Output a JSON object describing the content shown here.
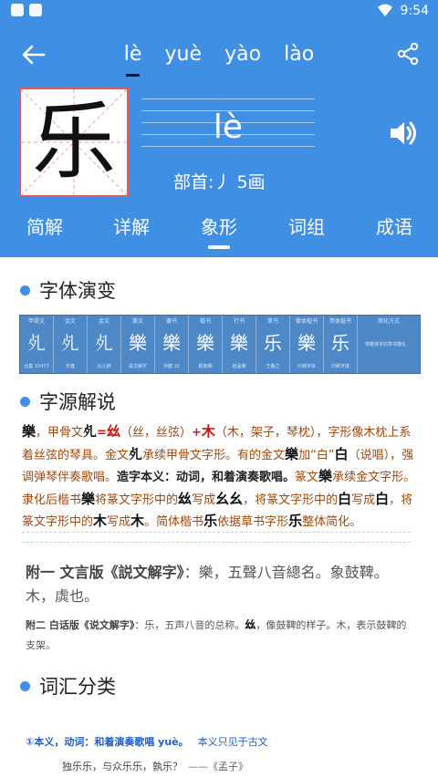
{
  "status_bar": {
    "time": "9:54"
  },
  "pinyin_tabs": [
    "lè",
    "yuè",
    "yào",
    "lào"
  ],
  "character": "乐",
  "reading": "lè",
  "radical_line": "部首:丿  5画",
  "section_tabs": [
    "简解",
    "详解",
    "象形",
    "词组",
    "成语"
  ],
  "sections": {
    "evolution": "字体演变",
    "etymology": "字源解说",
    "vocab": "词汇分类"
  },
  "evolution_table": {
    "columns": [
      {
        "label": "甲骨文",
        "glyph": "𣦷",
        "source": "合集 10477"
      },
      {
        "label": "金文",
        "glyph": "𣦷",
        "source": "乐簋"
      },
      {
        "label": "金文",
        "glyph": "𣦷",
        "source": "沇儿钟"
      },
      {
        "label": "篆文",
        "glyph": "樂",
        "source": "说文解字"
      },
      {
        "label": "隶书",
        "glyph": "樂",
        "source": "孙膑 15"
      },
      {
        "label": "楷书",
        "glyph": "樂",
        "source": "颜真卿"
      },
      {
        "label": "行书",
        "glyph": "樂",
        "source": "赵孟頫"
      },
      {
        "label": "草书",
        "glyph": "乐",
        "source": "王羲之"
      },
      {
        "label": "繁体楷书",
        "glyph": "樂",
        "source": "印刷字体"
      },
      {
        "label": "简体楷书",
        "glyph": "乐",
        "source": "印刷字体"
      }
    ],
    "last_header": "简化方式",
    "note": "将繁体字的草书楷化"
  },
  "etymology": {
    "t1": "樂",
    "t2": "，甲骨文",
    "t3": "（丝，丝弦）",
    "t4": "+",
    "t5": "（木，架子，琴枕）",
    "t6": "，字形像木枕上系着丝弦的琴具。金文",
    "t7": "承续甲骨文字形。有的金文",
    "t8": "加“白”",
    "t9": "（说唱），强调弹琴伴奏歌唱。",
    "t10": "造字本义：动词，和着演奏歌唱。",
    "t11": "篆文",
    "t12": "承续金文字形。隶化后楷书",
    "t13": "将篆文字形中的",
    "t14": "写成",
    "t15": "，将篆文字形中的",
    "t16": "写成",
    "t17": "，将篆文字形中的",
    "t18": "写成",
    "t19": "。简体楷书",
    "t20": "依据草书字形",
    "t21": "整体简化。",
    "g_jia": "𣦷",
    "g_si": "𢆶",
    "g_mu": "木",
    "g_jin": "𣦷",
    "g_jin2": "樂",
    "g_bai": "白",
    "g_zhuan": "樂",
    "g_kai": "樂",
    "g_a": "𢆶",
    "g_b": "幺幺",
    "g_c": "白",
    "g_d": "白",
    "g_e": "木",
    "g_f": "木",
    "g_jian": "乐",
    "g_cao": "乐"
  },
  "appendix_1": {
    "label": "附一  文言版《説文解字》",
    "text": "：樂，五聲八音總名。象鼓鞞。木，虡也。"
  },
  "appendix_2": {
    "label": "附二  白话版《说文解字》",
    "text": "：乐，五声八音的总称。",
    "glyph": "𢆶",
    "text2": "，像鼓鞞的样子。木，表示鼓鞞的支架。"
  },
  "vocab_item": {
    "head": "①本义，动词：和着演奏歌唱 yuè。",
    "note": "本义只见于古文",
    "example": "独乐乐，与众乐乐，孰乐？",
    "source": "——《孟子》"
  },
  "colors": {
    "header_blue": "#3f8fe4",
    "accent_red": "#e25b5b",
    "link_blue": "#1f5fc9",
    "brown": "#a0480e"
  }
}
